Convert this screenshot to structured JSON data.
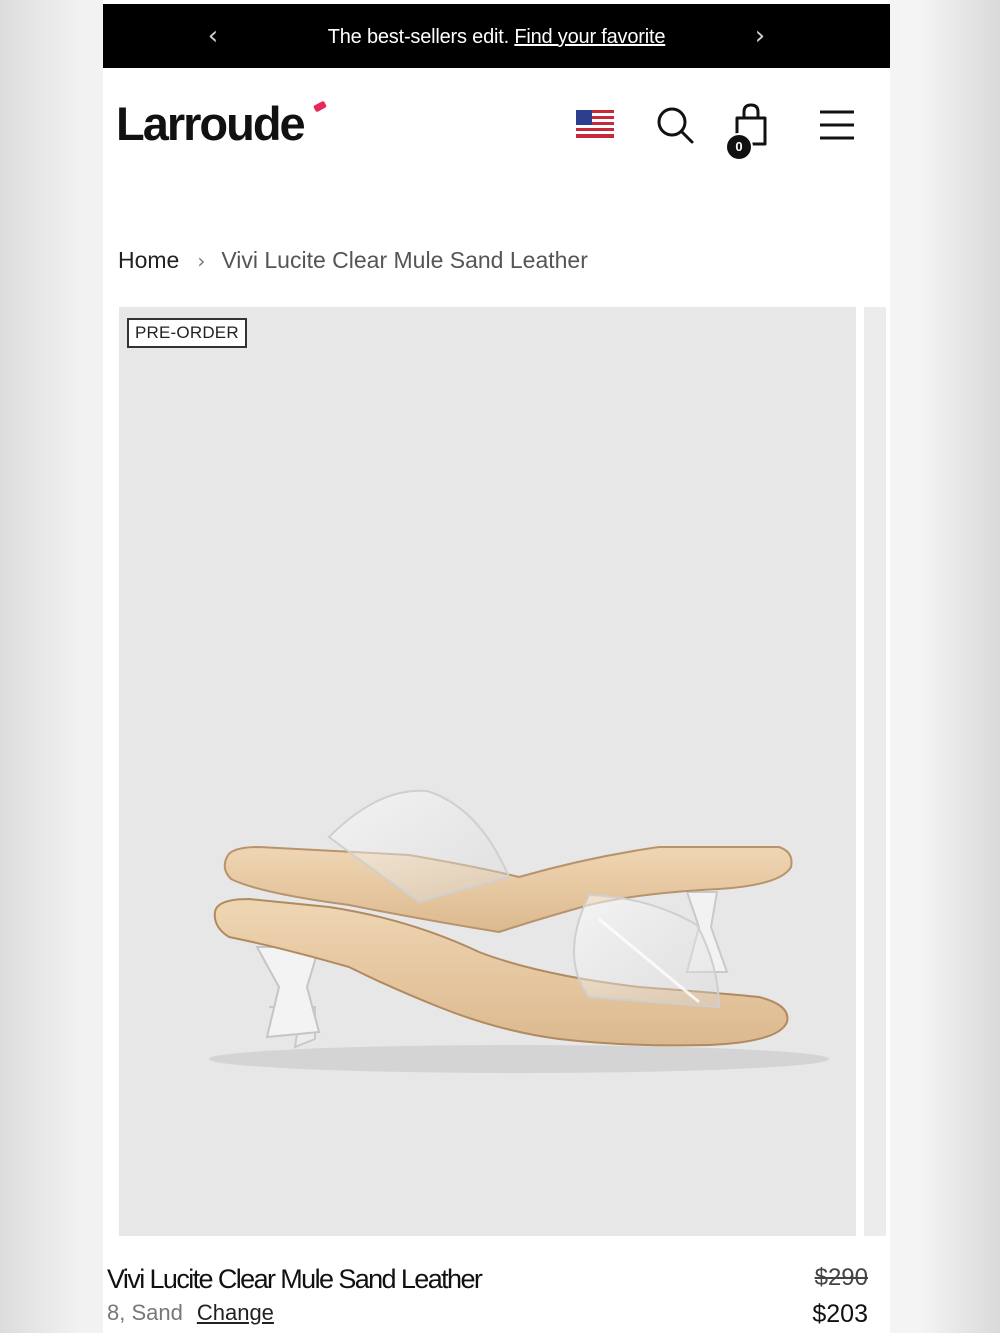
{
  "announcement": {
    "text": "The best-sellers edit.",
    "link": "Find your favorite",
    "prev": "‹",
    "next": "›"
  },
  "header": {
    "logo": "Larroude",
    "cart_count": "0",
    "icons": [
      "us-flag-icon",
      "search-icon",
      "shopping-bag-icon",
      "hamburger-menu-icon"
    ]
  },
  "breadcrumb": {
    "home": "Home",
    "separator": "›",
    "current": "Vivi Lucite Clear Mule Sand Leather"
  },
  "product": {
    "badge": "PRE-ORDER",
    "name": "Vivi Lucite Clear Mule Sand Leather",
    "variant": "8, Sand",
    "change_label": "Change",
    "price_original": "$290",
    "price_sale": "$203"
  },
  "colors": {
    "announcement_bg": "#000000",
    "logo_accent": "#e8285a",
    "image_bg": "#e7e7e7",
    "shoe_footbed": "#e9cca6"
  }
}
